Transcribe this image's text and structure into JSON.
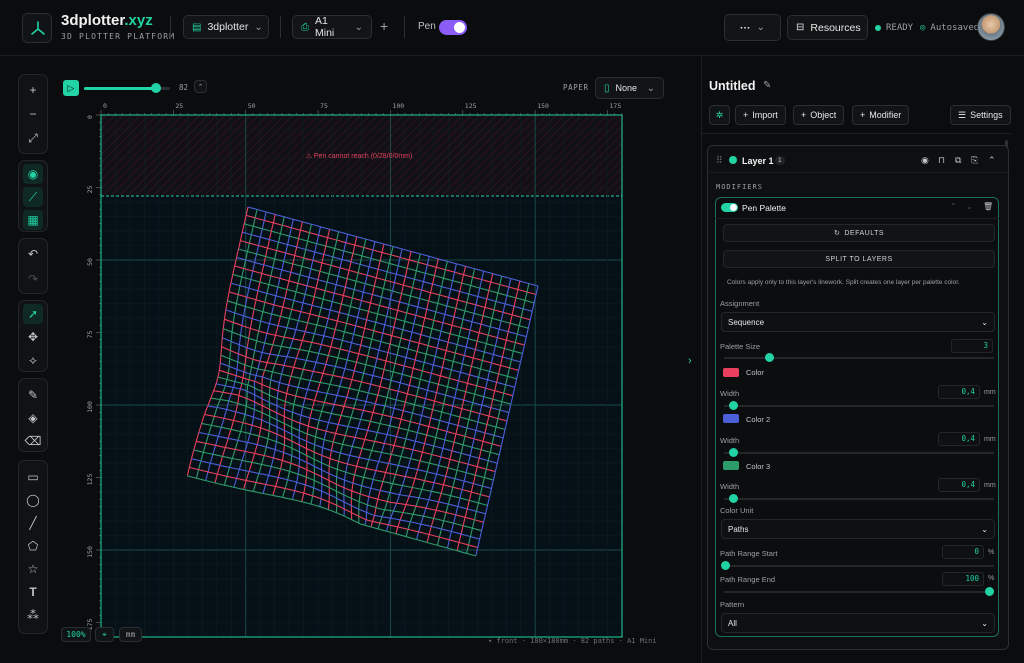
{
  "header": {
    "brand_main": "3dplotter",
    "brand_accent": ".xyz",
    "subtitle": "3D PLOTTER PLATFORM",
    "project_select": "3dplotter",
    "machine_select": "A1 Mini",
    "add_label": "+",
    "pen_label": "Pen",
    "more_label": "···",
    "resources_label": "Resources",
    "status_ready": "READY",
    "status_saved": "Autosaved"
  },
  "canvas": {
    "frame_value": "82",
    "paper_label": "PAPER",
    "paper_select": "None",
    "warning": "⚠ Pen cannot reach (0/28/0/0mm)",
    "zoom": "100%",
    "units": "mm",
    "footer": "▾ front · 180×180mm · 82 paths · A1 Mini",
    "x_ticks": [
      "0",
      "25",
      "50",
      "75",
      "100",
      "125",
      "150",
      "175"
    ],
    "y_ticks": [
      "0",
      "25",
      "50",
      "75",
      "100",
      "125",
      "150",
      "175"
    ],
    "frame_fraction": 0.84
  },
  "panel": {
    "title": "Untitled",
    "import_label": "Import",
    "object_label": "Object",
    "modifier_label": "Modifier",
    "settings_label": "Settings",
    "layer_name": "Layer 1",
    "layer_count": "1",
    "modifiers_heading": "MODIFIERS",
    "modifier_name": "Pen Palette",
    "defaults_label": "DEFAULTS",
    "split_label": "SPLIT TO LAYERS",
    "help_text": "Colors apply only to this layer's linework. Split creates one layer per palette color.",
    "assignment_label": "Assignment",
    "assignment_value": "Sequence",
    "palette_size_label": "Palette Size",
    "palette_size_value": "3",
    "colors": [
      {
        "label": "Color",
        "hex": "#e8405e",
        "width_label": "Width",
        "width_value": "0,4",
        "unit": "mm"
      },
      {
        "label": "Color 2",
        "hex": "#4b5fd8",
        "width_label": "Width",
        "width_value": "0,4",
        "unit": "mm"
      },
      {
        "label": "Color 3",
        "hex": "#2e9b6a",
        "width_label": "Width",
        "width_value": "0,4",
        "unit": "mm"
      }
    ],
    "color_unit_label": "Color Unit",
    "color_unit_value": "Paths",
    "range_start_label": "Path Range Start",
    "range_start_value": "0",
    "range_end_label": "Path Range End",
    "range_end_value": "100",
    "percent": "%",
    "pattern_label": "Pattern",
    "pattern_value": "All"
  },
  "colors": {
    "accent": "#22d3a6",
    "toggle": "#8b5cf6",
    "warning": "#e0455a"
  }
}
